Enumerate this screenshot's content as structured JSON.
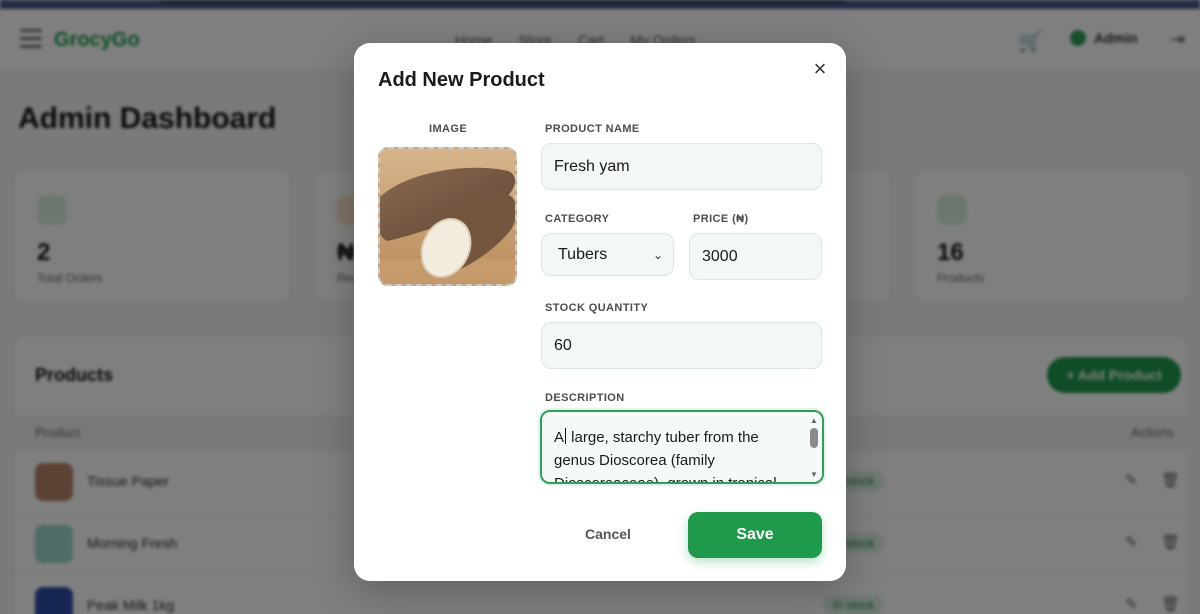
{
  "background": {
    "brand": "GrocyGo",
    "nav_links": [
      "Home",
      "Store",
      "Cart",
      "My Orders"
    ],
    "user_name": "Admin",
    "dashboard_title": "Admin Dashboard",
    "stats": [
      {
        "value": "2",
        "label": "Total Orders",
        "icon_color": "#d9f0df"
      },
      {
        "value": "₦",
        "label": "Revenue",
        "icon_color": "#fde7cf"
      },
      {
        "value": "",
        "label": "",
        "icon_color": "#e3ecf8"
      },
      {
        "value": "16",
        "label": "Products",
        "icon_color": "#d9f0df"
      }
    ],
    "products_title": "Products",
    "add_product_label": "+ Add Product",
    "table_headers": {
      "product": "Product",
      "actions": "Actions"
    },
    "rows": [
      {
        "name": "Tissue Paper",
        "status": "In stock"
      },
      {
        "name": "Morning Fresh",
        "status": "In stock"
      },
      {
        "name": "Peak Milk 1kg",
        "status": "In stock"
      }
    ]
  },
  "modal": {
    "title": "Add New Product",
    "close_icon": "close-icon",
    "image_label": "IMAGE",
    "product_name_label": "PRODUCT NAME",
    "product_name_value": "Fresh yam",
    "category_label": "CATEGORY",
    "category_value": "Tubers",
    "price_label": "PRICE (₦)",
    "price_value": "3000",
    "stock_label": "STOCK QUANTITY",
    "stock_value": "60",
    "description_label": "DESCRIPTION",
    "description_value_start": "A",
    "description_value_rest": " large, starchy tuber from the genus Dioscorea (family Dioscoreaceae), grown in tropical",
    "cancel_label": "Cancel",
    "save_label": "Save"
  },
  "colors": {
    "accent": "#1f9a4d",
    "overlay": "rgba(0,0,0,0.5)"
  }
}
